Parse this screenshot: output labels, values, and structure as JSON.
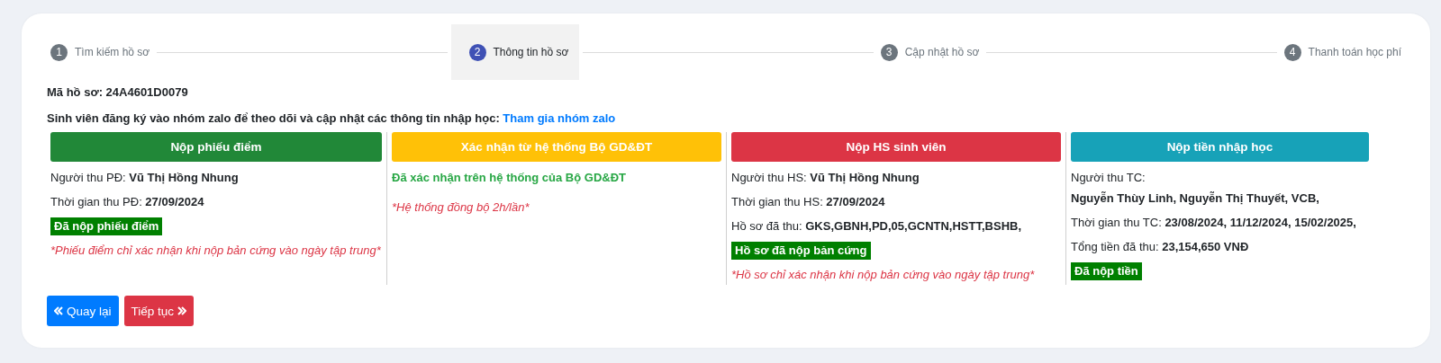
{
  "steps": [
    {
      "number": "1",
      "label": "Tìm kiếm hồ sơ",
      "selected": false
    },
    {
      "number": "2",
      "label": "Thông tin hồ sơ",
      "selected": true
    },
    {
      "number": "3",
      "label": "Cập nhật hồ sơ",
      "selected": false
    },
    {
      "number": "4",
      "label": "Thanh toán học phí",
      "selected": false
    }
  ],
  "record_code": {
    "label": "Mã hồ sơ:",
    "value": "24A4601D0079"
  },
  "zalo_note": {
    "text": "Sinh viên đăng ký vào nhóm zalo để theo dõi và cập nhật các thông tin nhập học:",
    "link": "Tham gia nhóm zalo"
  },
  "columns": [
    {
      "title": "Nộp phiếu điểm",
      "color": "#218838",
      "lines": [
        {
          "kind": "field",
          "label": "Người thu PĐ:",
          "value": "Vũ Thị Hồng Nhung"
        },
        {
          "kind": "field",
          "label": "Thời gian thu PĐ:",
          "value": "27/09/2024"
        },
        {
          "kind": "badge",
          "text": "Đã nộp phiếu điểm"
        },
        {
          "kind": "note",
          "text": "*Phiếu điểm chỉ xác nhận khi nộp bản cứng vào ngày tập trung*"
        }
      ]
    },
    {
      "title": "Xác nhận từ hệ thống Bộ GD&ĐT",
      "color": "#ffc107",
      "lines": [
        {
          "kind": "confirm",
          "text": "Đã xác nhận trên hệ thống của Bộ GD&ĐT"
        },
        {
          "kind": "note",
          "text": "*Hệ thống đồng bộ 2h/lần*"
        }
      ]
    },
    {
      "title": "Nộp HS sinh viên",
      "color": "#dc3545",
      "lines": [
        {
          "kind": "field",
          "label": "Người thu HS:",
          "value": "Vũ Thị Hồng Nhung"
        },
        {
          "kind": "field",
          "label": "Thời gian thu HS:",
          "value": "27/09/2024"
        },
        {
          "kind": "field",
          "label": "Hồ sơ đã thu:",
          "value": "GKS,GBNH,PD,05,GCNTN,HSTT,BSHB,"
        },
        {
          "kind": "badge",
          "text": "Hồ sơ đã nộp bản cứng"
        },
        {
          "kind": "note",
          "text": "*Hồ sơ chỉ xác nhận khi nộp bản cứng vào ngày tập trung*"
        }
      ]
    },
    {
      "title": "Nộp tiền nhập học",
      "color": "#17a2b8",
      "lines": [
        {
          "kind": "label",
          "text": "Người thu TC:"
        },
        {
          "kind": "strong",
          "text": "Nguyễn Thùy Linh, Nguyễn Thị Thuyết, VCB,"
        },
        {
          "kind": "field",
          "label": "Thời gian thu TC:",
          "value": "23/08/2024, 11/12/2024, 15/02/2025,"
        },
        {
          "kind": "field",
          "label": "Tổng tiền đã thu:",
          "value": "23,154,650 VNĐ"
        },
        {
          "kind": "badge",
          "text": "Đã nộp tiền"
        }
      ]
    }
  ],
  "buttons": [
    {
      "label": "Quay lại",
      "kind": "back"
    },
    {
      "label": "Tiếp tục",
      "kind": "next"
    }
  ]
}
